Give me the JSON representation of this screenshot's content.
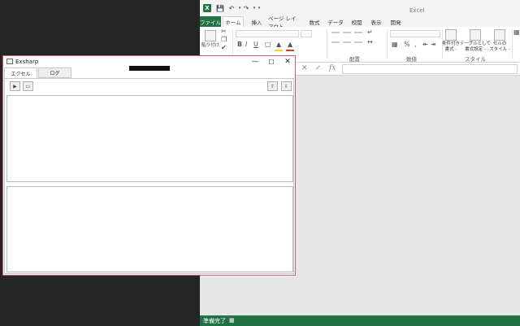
{
  "excel": {
    "title": "Excel",
    "logo": "X",
    "qat": {
      "save_icon": "save-icon",
      "undo_icon": "undo-icon",
      "redo_icon": "redo-icon"
    },
    "tabs": [
      "ファイル",
      "ホーム",
      "挿入",
      "ページ レイアウト",
      "数式",
      "データ",
      "校閲",
      "表示",
      "開発"
    ],
    "ribbon": {
      "paste_label": "貼り付け",
      "bold": "B",
      "italic": "I",
      "underline": "U",
      "groups": {
        "alignment": "配置",
        "number": "数値",
        "style": "スタイル"
      },
      "percent": "%",
      "comma": ",",
      "cond_format": "条件付き\n書式 -",
      "format_table": "テーブルとして\n書式設定 -",
      "cell_style": "セルの\nスタイル -"
    },
    "formula": {
      "cancel": "✕",
      "enter": "✓",
      "fx": "fx"
    },
    "status": "準備完了"
  },
  "exsharp": {
    "title": "Exsharp",
    "controls": {
      "minimize": "—",
      "maximize": "☐",
      "close": "✕"
    },
    "tabs": {
      "excel": "エクセル",
      "log": "ログ"
    },
    "toolbar": {
      "run": "▶",
      "book": "▭",
      "up": "⇧",
      "down": "⇩"
    }
  }
}
